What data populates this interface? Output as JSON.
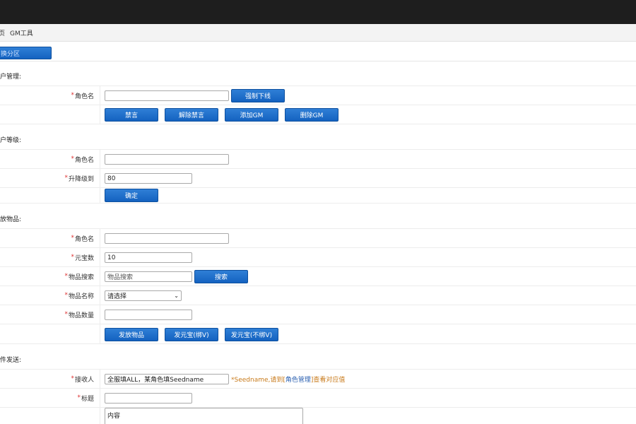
{
  "breadcrumb": {
    "home": "页",
    "title": "GM工具"
  },
  "switch_button": "换分区",
  "sections": {
    "player_mgmt": "户管理:",
    "player_level": "户等级:",
    "send_items": "放物品:",
    "mail_send": "件发送:"
  },
  "labels": {
    "role_name": "角色名",
    "level_to": "升降级到",
    "yuanbao_count": "元宝数",
    "item_search": "物品搜索",
    "item_name": "物品名称",
    "item_qty": "物品数量",
    "receiver": "接收人",
    "title": "标题"
  },
  "buttons": {
    "force_offline": "强制下线",
    "mute": "禁言",
    "unmute": "解除禁言",
    "add_gm": "添加GM",
    "remove_gm": "删除GM",
    "confirm": "确定",
    "search": "搜索",
    "send_items": "发放物品",
    "send_yb_bind": "发元宝(绑V)",
    "send_yb_unbind": "发元宝(不绑V)"
  },
  "fields": {
    "level_value": "80",
    "yuanbao_value": "10",
    "item_search_placeholder": "物品搜索",
    "item_select_value": "请选择",
    "receiver_value": "全服填ALL，某角色填Seedname",
    "content_placeholder": "内容"
  },
  "hint": {
    "prefix": "*Seedname,请到[",
    "link": "角色管理",
    "suffix": "]查看对应值"
  }
}
